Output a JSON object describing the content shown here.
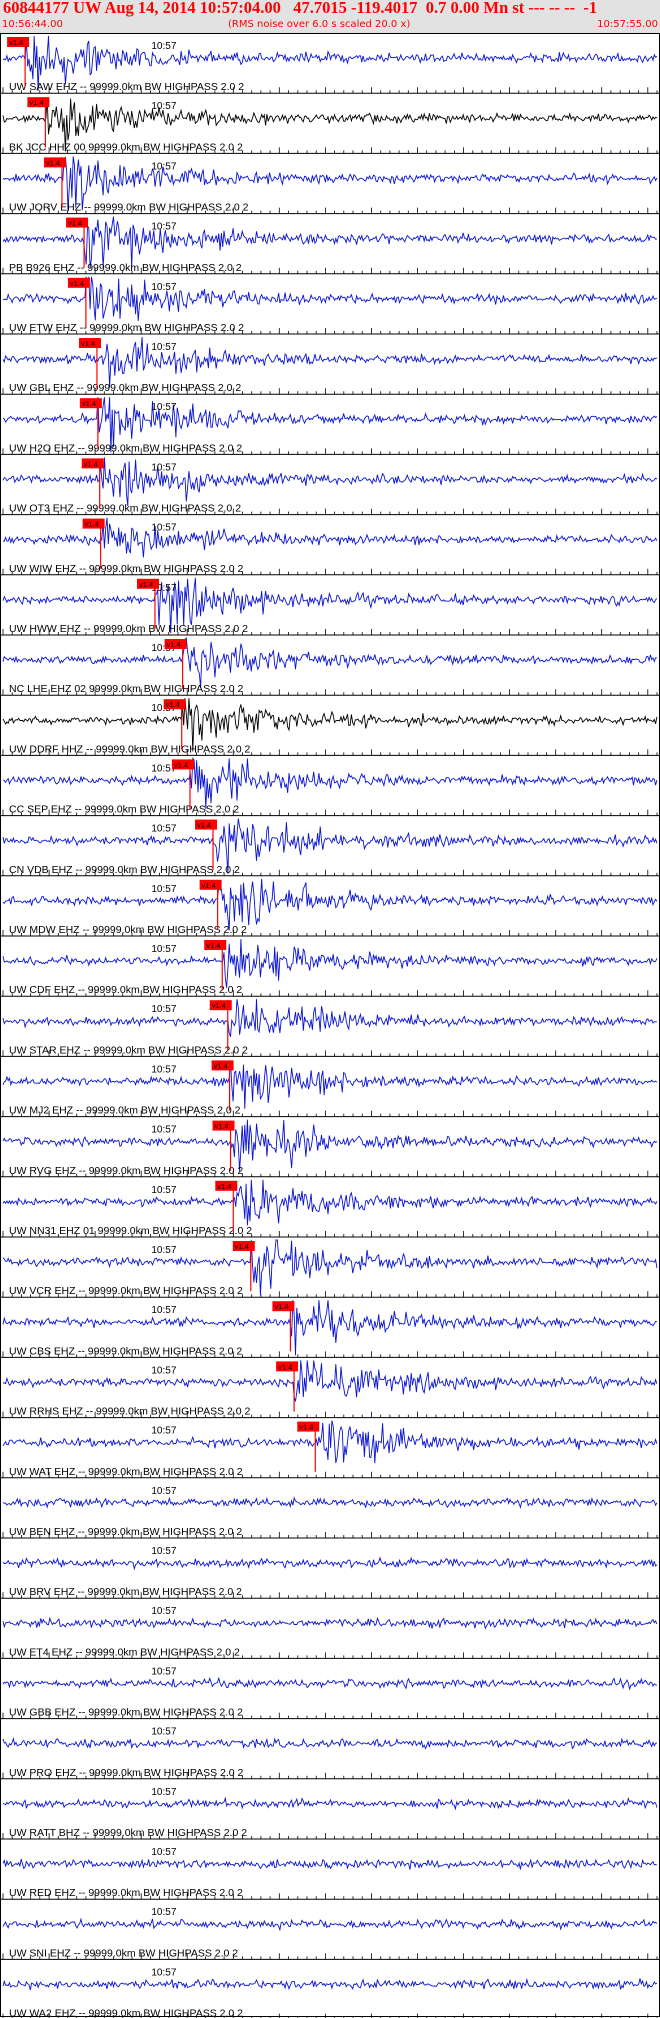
{
  "header": {
    "event_line": "60844177 UW Aug 14, 2014 10:57:04.00   47.7015 -119.4017  0.7 0.00 Mn st --- -- --  -1",
    "start_time": "10:56:44.00",
    "noise_note": "(RMS noise over 6.0 s scaled 20.0 x)",
    "end_time": "10:57:55.00"
  },
  "chart_data": {
    "type": "line",
    "time_range": [
      "10:56:44.00",
      "10:57:55.00"
    ],
    "tick_label": "10:57",
    "pick_label": "v1.4",
    "colors": {
      "trace": "#0a14d2",
      "black_trace": "#000000",
      "pick": "#ff0000",
      "header_text": "#ff0000"
    },
    "traces": [
      {
        "label": "UW SAW  EHZ -- 99999.0km BW  HIGHPASS  2.0  2",
        "color": "blue",
        "pick": 2.4
      },
      {
        "label": "BK JCC  HHZ 00 99999.0km BW  HIGHPASS  2.0  2",
        "color": "black",
        "pick": 4.6
      },
      {
        "label": "UW JORV EHZ -- 99999.0km BW  HIGHPASS  2.0  2",
        "color": "blue",
        "pick": 6.4
      },
      {
        "label": "PB B926 EHZ -- 99999.0km BW  HIGHPASS  2.0  2",
        "color": "blue",
        "pick": 8.8
      },
      {
        "label": "UW ETW  EHZ -- 99999.0km BW  HIGHPASS  2.0  2",
        "color": "blue",
        "pick": 9.0
      },
      {
        "label": "UW GBL  EHZ -- 99999.0km BW  HIGHPASS  2.0  2",
        "color": "blue",
        "pick": 10.2
      },
      {
        "label": "UW H2O  EHZ -- 99999.0km BW  HIGHPASS  2.0  2",
        "color": "blue",
        "pick": 10.3
      },
      {
        "label": "UW OT3  EHZ -- 99999.0km BW  HIGHPASS  2.0  2",
        "color": "blue",
        "pick": 10.5
      },
      {
        "label": "UW WIW  EHZ -- 99999.0km BW  HIGHPASS  2.0  2",
        "color": "blue",
        "pick": 10.6
      },
      {
        "label": "UW HWW  EHZ -- 99999.0km BW  HIGHPASS  2.0  2",
        "color": "blue",
        "pick": 16.5
      },
      {
        "label": "NC LHE  EHZ 02 99999.0km BW  HIGHPASS  2.0  2",
        "color": "blue",
        "pick": 19.5
      },
      {
        "label": "UW DDRF HHZ -- 99999.0km BW  HIGHPASS  2.0  2",
        "color": "black",
        "pick": 19.4
      },
      {
        "label": "CC SEP  EHZ -- 99999.0km BW  HIGHPASS  2.0  2",
        "color": "blue",
        "pick": 20.3
      },
      {
        "label": "CN VDB  EHZ -- 99999.0km BW  HIGHPASS  2.0  2",
        "color": "blue",
        "pick": 22.8
      },
      {
        "label": "UW MDW  EHZ -- 99999.0km BW  HIGHPASS  2.0  2",
        "color": "blue",
        "pick": 23.3
      },
      {
        "label": "UW CDF  EHZ -- 99999.0km BW  HIGHPASS  2.0  2",
        "color": "blue",
        "pick": 23.8
      },
      {
        "label": "UW STAR EHZ -- 99999.0km BW  HIGHPASS  2.0  2",
        "color": "blue",
        "pick": 24.4
      },
      {
        "label": "UW MJ2  EHZ -- 99999.0km BW  HIGHPASS  2.0  2",
        "color": "blue",
        "pick": 24.6
      },
      {
        "label": "UW RVG  EHZ -- 99999.0km BW  HIGHPASS  2.0  2",
        "color": "blue",
        "pick": 24.7
      },
      {
        "label": "UW NN31 EHZ 01 99999.0km BW  HIGHPASS  2.0  2",
        "color": "blue",
        "pick": 25.0
      },
      {
        "label": "UW VCR  EHZ -- 99999.0km BW  HIGHPASS  2.0  2",
        "color": "blue",
        "pick": 26.9
      },
      {
        "label": "UW CBS  EHZ -- 99999.0km BW  HIGHPASS  2.0  2",
        "color": "blue",
        "pick": 31.2
      },
      {
        "label": "UW RRHS EHZ -- 99999.0km BW  HIGHPASS  2.0  2",
        "color": "blue",
        "pick": 31.6
      },
      {
        "label": "UW WAT  EHZ -- 99999.0km BW  HIGHPASS  2.0  2",
        "color": "blue",
        "pick": 33.9
      },
      {
        "label": "UW BEN  EHZ -- 99999.0km BW  HIGHPASS  2.0  2",
        "color": "blue"
      },
      {
        "label": "UW BRV  EHZ -- 99999.0km BW  HIGHPASS  2.0  2",
        "color": "blue"
      },
      {
        "label": "UW ET4  EHZ -- 99999.0km BW  HIGHPASS  2.0  2",
        "color": "blue"
      },
      {
        "label": "UW GBB  EHZ -- 99999.0km BW  HIGHPASS  2.0  2",
        "color": "blue"
      },
      {
        "label": "UW PRO  EHZ -- 99999.0km BW  HIGHPASS  2.0  2",
        "color": "blue"
      },
      {
        "label": "UW RATT BHZ -- 99999.0km BW  HIGHPASS  2.0  2",
        "color": "blue"
      },
      {
        "label": "UW RED  EHZ -- 99999.0km BW  HIGHPASS  2.0  2",
        "color": "blue"
      },
      {
        "label": "UW SNI  EHZ -- 99999.0km BW  HIGHPASS  2.0  2",
        "color": "blue"
      },
      {
        "label": "UW WA2  EHZ -- 99999.0km BW  HIGHPASS  2.0  2",
        "color": "blue"
      }
    ]
  }
}
